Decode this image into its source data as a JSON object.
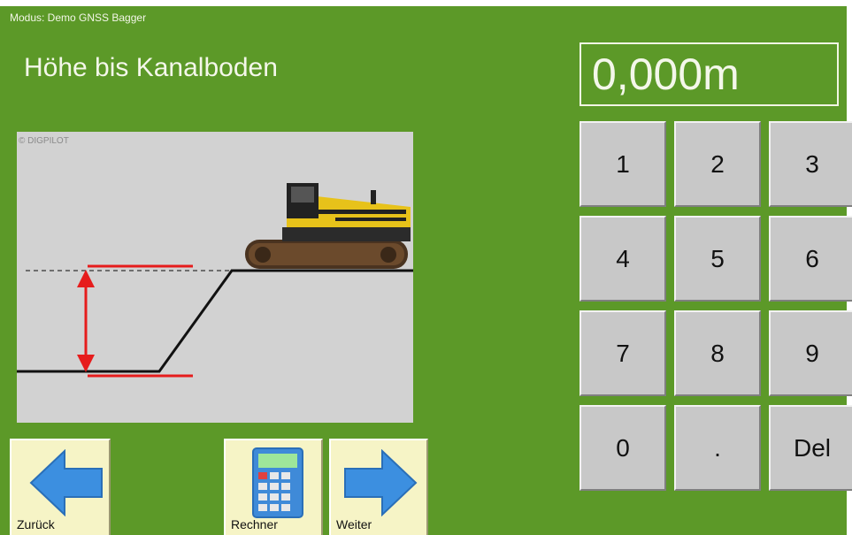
{
  "header": {
    "mode_text": "Modus: Demo GNSS Bagger",
    "title": "Höhe bis Kanalboden"
  },
  "display": {
    "value": "0,000m"
  },
  "illustration": {
    "copyright": "© DIGPILOT"
  },
  "keypad": {
    "keys": [
      "1",
      "2",
      "3",
      "4",
      "5",
      "6",
      "7",
      "8",
      "9",
      "0",
      ".",
      "Del"
    ]
  },
  "nav": {
    "back_label": "Zurück",
    "calc_label": "Rechner",
    "next_label": "Weiter"
  },
  "colors": {
    "background": "#5c9928",
    "key": "#c8c8c8",
    "nav_button": "#f6f4c6",
    "arrow_blue": "#3c8fe0",
    "marker_red": "#e61c1c"
  },
  "icons": {
    "back": "arrow-left-icon",
    "calculator": "calculator-icon",
    "next": "arrow-right-icon",
    "excavator": "excavator-icon"
  }
}
